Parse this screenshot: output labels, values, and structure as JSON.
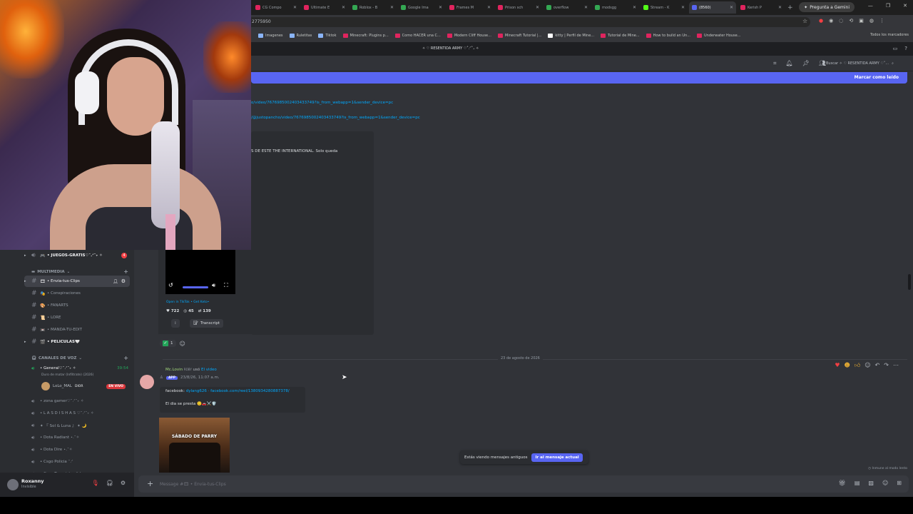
{
  "browser": {
    "tabs": [
      {
        "label": "CG Compo",
        "color": "#e0245e"
      },
      {
        "label": "Ultimate E",
        "color": "#e0245e"
      },
      {
        "label": "Roblox - B",
        "color": "#34a853"
      },
      {
        "label": "Google Ima",
        "color": "#34a853"
      },
      {
        "label": "Frames M",
        "color": "#e0245e"
      },
      {
        "label": "Prison sch",
        "color": "#e0245e"
      },
      {
        "label": "overflow",
        "color": "#34a853"
      },
      {
        "label": "modsgg",
        "color": "#34a853"
      },
      {
        "label": "Stream - K",
        "color": "#53fc18"
      },
      {
        "label": "(8560)",
        "color": "#5865f2",
        "active": true
      },
      {
        "label": "Kerish P",
        "color": "#e0245e"
      }
    ],
    "gemini": "Pregunta a Gemini",
    "url": "2775950",
    "bookmarks": [
      {
        "label": "Imagenes",
        "color": "#8ab4f8"
      },
      {
        "label": "Ruletitas",
        "color": "#8ab4f8"
      },
      {
        "label": "Tiktok",
        "color": "#8ab4f8"
      },
      {
        "label": "Minecraft: Plugins p...",
        "color": "#e0245e"
      },
      {
        "label": "Como HACER una C...",
        "color": "#e0245e"
      },
      {
        "label": "Modern Cliff House...",
        "color": "#e0245e"
      },
      {
        "label": "Minecraft Tutorial |...",
        "color": "#e0245e"
      },
      {
        "label": "kitty | Perfil de Mine...",
        "color": "#ffffff"
      },
      {
        "label": "Tutorial de Mine...",
        "color": "#e0245e"
      },
      {
        "label": "How to build an Un...",
        "color": "#e0245e"
      },
      {
        "label": "Underwater House...",
        "color": "#e0245e"
      }
    ],
    "all_bookmarks": "Todos los marcadores"
  },
  "discord": {
    "server_title": "✧ ♡ RESENTIDA ARMY ♡˚.ᐟ˚₊ ✧",
    "search_placeholder": "Buscar ✧ ♡ RESENTIDA ARMY ♡˚...",
    "mark_read": "Marcar como leído",
    "sidebar": {
      "channel_top": {
        "emoji": "🎮",
        "name": "• JUEGOS-GRATIS♡˚.ᐟ˚₊ ✧",
        "badge": "4"
      },
      "category_media": "MULTIMEDIA",
      "channels": [
        {
          "emoji": "🎞",
          "name": "• Envia-tus-Clips",
          "selected": true
        },
        {
          "emoji": "🎭",
          "name": "• Conspiraciones"
        },
        {
          "emoji": "🎨",
          "name": "• FANARTS"
        },
        {
          "emoji": "📜",
          "name": "• LORE"
        },
        {
          "emoji": "📼",
          "name": "• MANDA-TU-EDIT"
        },
        {
          "emoji": "🎬",
          "name": "• PELICULAS🤍",
          "bold": true
        }
      ],
      "category_voice": "CANALES DE VOZ",
      "voice_general": {
        "name": "• General♡˚.ᐟ˚₊ ✧",
        "timer": "39:54",
        "sub": "Duro de matar (Infiltrate) (2026)"
      },
      "voice_user": {
        "name": "LoLo_MAL",
        "tag": "DIOR",
        "live": "EN VIVO"
      },
      "voice_channels": [
        "• zona gamer♡˚.ᐟ˚₊ ✧",
        "• L A S D I S H A S ♡˚.ᐟ˚₊ ✧",
        "✦ 『 Sol & Luna 』 ✦ 🌙",
        "• Dota Radiant ⋆.˚✧",
        "• Dota Dire ⋆.˚✧",
        "• Csgo Policia ˚.ᐟ",
        "• Csgo Terroristas ˚.ᐟ"
      ]
    },
    "user": {
      "name": "Roxanny",
      "status": "Invisible"
    },
    "messages": {
      "link1": "o/video/7676985002403433749?is_from_webapp=1&sender_device=pc",
      "link2": "/@justopancho/video/7676985002403433749?is_from_webapp=1&sender_device=pc",
      "embed_text": "S DE ESTE THE INTERNATIONAL. Solo queda",
      "tiktok_link": "Open in TikTok • Get Keto•",
      "stats": {
        "likes": "722",
        "comments": "45",
        "shares": "139"
      },
      "transcript": "Transcript",
      "reaction_count": "1",
      "date_divider": "23 de agosto de 2026",
      "reply": {
        "name": "Mc.Lovin",
        "tag": "ROBY",
        "verb": "usó",
        "target": "El video"
      },
      "author_time": "23/8/26, 11:07 a.m.",
      "app_tag": "APP",
      "line1_prefix": "facebook:",
      "line1_user": "dylang626",
      "line1_link": "· facebook.com/reel/1380934280887378/",
      "line2": "El dia se presta 🙂🚗⚔️🛡️",
      "thumb_caption": "SÁBADO DE PARRY"
    },
    "jump": {
      "text": "Estás viendo mensajes antiguos",
      "button": "Ir al mensaje actual"
    },
    "slowmode": "Inmune al modo lento",
    "composer_placeholder": "Message #🎞 • Envia-tus-Clips"
  }
}
